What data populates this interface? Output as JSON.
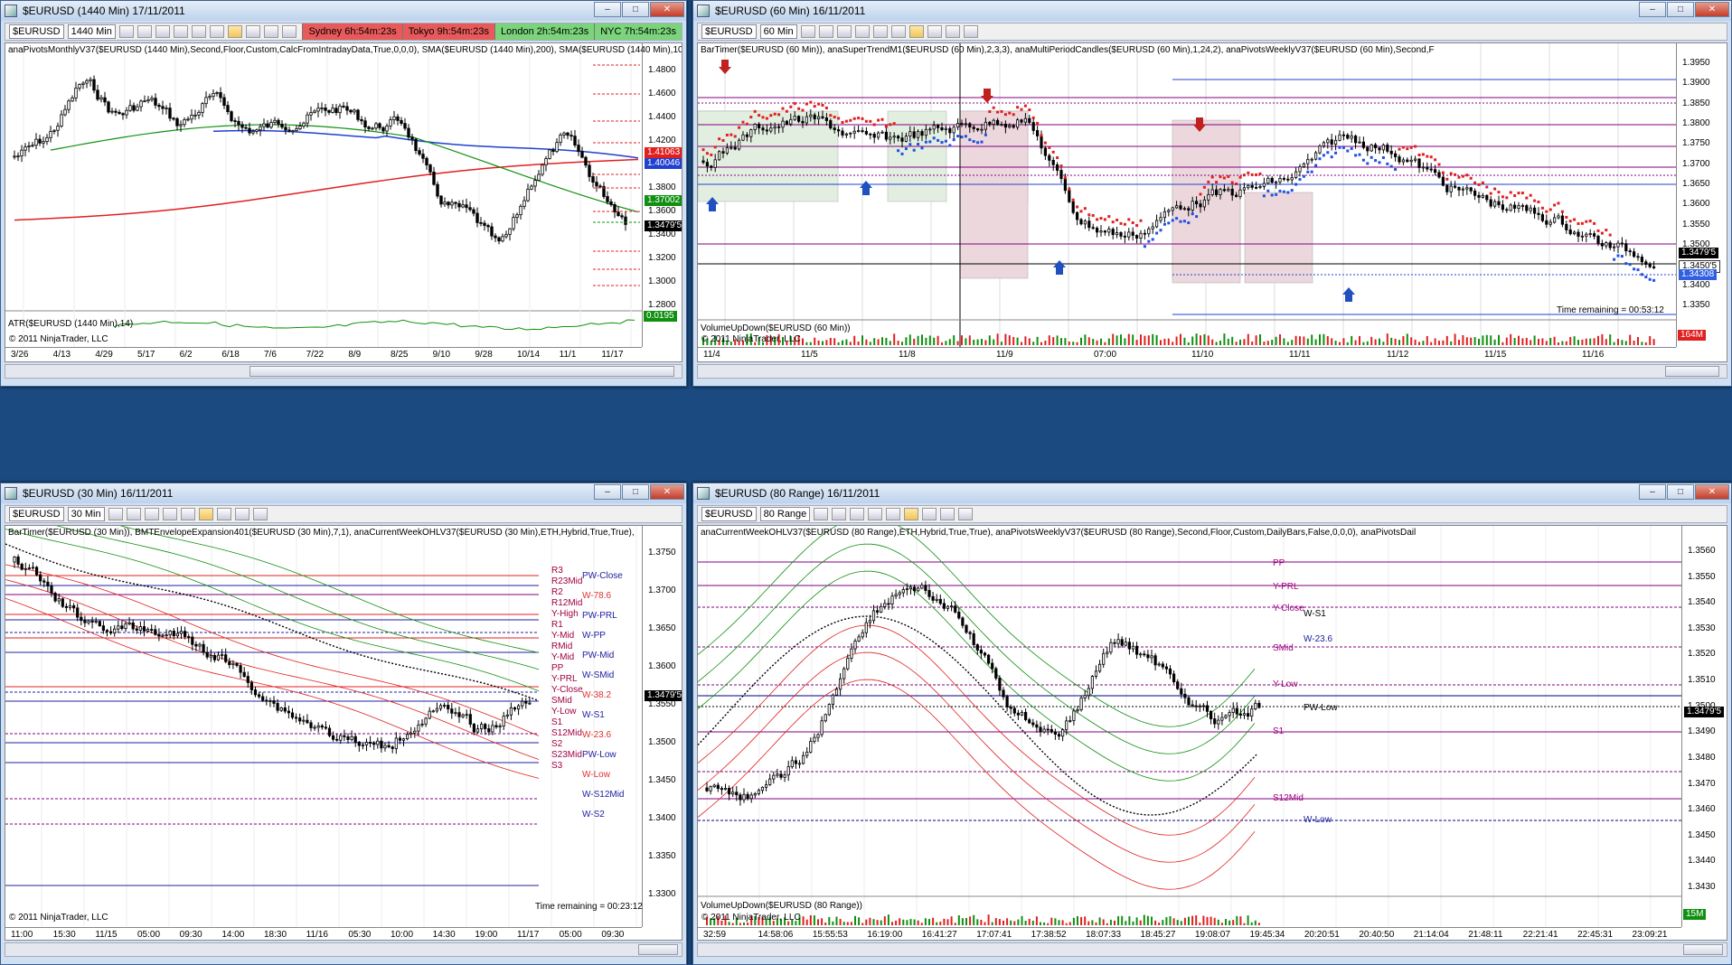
{
  "windows": [
    {
      "id": "w1",
      "title": "$EURUSD (1440 Min)  17/11/2011",
      "instrument": "$EURUSD",
      "interval": "1440 Min",
      "sessions": [
        {
          "label": "Sydney 6h:54m:23s",
          "color": "#e85a5a"
        },
        {
          "label": "Tokyo 9h:54m:23s",
          "color": "#e85a5a"
        },
        {
          "label": "London 2h:54m:23s",
          "color": "#7bd47b"
        },
        {
          "label": "NYC 7h:54m:23s",
          "color": "#7bd47b"
        }
      ],
      "indicator_label": "anaPivotsMonthlyV37($EURUSD (1440 Min),Second,Floor,Custom,CalcFromIntradayData,True,0,0,0), SMA($EURUSD (1440 Min),200), SMA($EURUSD (1440 Min),100), SM",
      "price_ticks": [
        "1.4800",
        "1.4600",
        "1.4400",
        "1.4200",
        "1.4000",
        "1.3800",
        "1.3600",
        "1.3400",
        "1.3200",
        "1.3000",
        "1.2800"
      ],
      "badges": [
        {
          "label": "1.41063",
          "color": "#e02020"
        },
        {
          "label": "1.40046",
          "color": "#2040d0"
        },
        {
          "label": "1.37002",
          "color": "#109010"
        },
        {
          "label": "1.3479'5",
          "color": "#000000"
        }
      ],
      "sub_label": "ATR($EURUSD (1440 Min),14)",
      "sub_badge": "0.0195",
      "copyright": "© 2011 NinjaTrader, LLC",
      "time_ticks": [
        "3/26",
        "4/13",
        "4/29",
        "5/17",
        "6/2",
        "6/18",
        "7/6",
        "7/22",
        "8/9",
        "8/25",
        "9/10",
        "9/28",
        "10/14",
        "11/1",
        "11/17"
      ]
    },
    {
      "id": "w2",
      "title": "$EURUSD (60 Min)  16/11/2011",
      "instrument": "$EURUSD",
      "interval": "60 Min",
      "indicator_label": "BarTimer($EURUSD (60 Min)), anaSuperTrendM1($EURUSD (60 Min),2,3,3), anaMultiPeriodCandles($EURUSD (60 Min),1,24,2), anaPivotsWeeklyV37($EURUSD (60 Min),Second,F",
      "price_ticks": [
        "1.3950",
        "1.3900",
        "1.3850",
        "1.3800",
        "1.3750",
        "1.3700",
        "1.3650",
        "1.3600",
        "1.3550",
        "1.3500",
        "1.3450",
        "1.3400",
        "1.3350"
      ],
      "badges": [
        {
          "label": "1.3479'5",
          "color": "#000000"
        },
        {
          "label": "1.3450'5",
          "color": "#ffffff"
        },
        {
          "label": "1.34308",
          "color": "#3060e0"
        }
      ],
      "time_remaining": "Time remaining = 00:53:12",
      "sub_label": "VolumeUpDown($EURUSD (60 Min))",
      "sub_badge": "164M",
      "copyright": "© 2011 NinjaTrader, LLC",
      "time_ticks": [
        "11/4",
        "11/5",
        "11/8",
        "11/9",
        "07:00",
        "11/10",
        "11/11",
        "11/12",
        "11/15",
        "11/16"
      ]
    },
    {
      "id": "w3",
      "title": "$EURUSD (30 Min)  16/11/2011",
      "instrument": "$EURUSD",
      "interval": "30 Min",
      "indicator_label": "BarTimer($EURUSD (30 Min)), BMTEnvelopeExpansion401($EURUSD (30 Min),7,1), anaCurrentWeekOHLV37($EURUSD (30 Min),ETH,Hybrid,True,True), anaPivotsWeekl",
      "price_ticks": [
        "1.3750",
        "1.3700",
        "1.3650",
        "1.3600",
        "1.3550",
        "1.3500",
        "1.3450",
        "1.3400",
        "1.3350",
        "1.3300"
      ],
      "badges": [
        {
          "label": "1.3479'5",
          "color": "#000000"
        }
      ],
      "levels": [
        {
          "label": "R3",
          "color": "#a00040"
        },
        {
          "label": "PW-Close",
          "color": "#2020a0"
        },
        {
          "label": "R23Mid",
          "color": "#a00040"
        },
        {
          "label": "W-78.6",
          "color": "#e03030"
        },
        {
          "label": "PW-PRL",
          "color": "#2020a0"
        },
        {
          "label": "R2",
          "color": "#a00040"
        },
        {
          "label": "W-PP",
          "color": "#2020a0"
        },
        {
          "label": "PW-Mid",
          "color": "#2020a0"
        },
        {
          "label": "R12Mid",
          "color": "#a00040"
        },
        {
          "label": "Y-High",
          "color": "#a00040"
        },
        {
          "label": "R1",
          "color": "#a00040"
        },
        {
          "label": "Y-Mid",
          "color": "#a00040"
        },
        {
          "label": "W-SMid",
          "color": "#2020a0"
        },
        {
          "label": "RMid",
          "color": "#a00040"
        },
        {
          "label": "W-38.2",
          "color": "#e03030"
        },
        {
          "label": "Y-Mid",
          "color": "#a00040"
        },
        {
          "label": "PP",
          "color": "#a00040"
        },
        {
          "label": "Y-PRL",
          "color": "#a00040"
        },
        {
          "label": "Y-Close",
          "color": "#a00040"
        },
        {
          "label": "W-S1",
          "color": "#2020a0"
        },
        {
          "label": "SMid",
          "color": "#a00040"
        },
        {
          "label": "W-23.6",
          "color": "#e03030"
        },
        {
          "label": "Y-Low",
          "color": "#a00040"
        },
        {
          "label": "S1",
          "color": "#a00040"
        },
        {
          "label": "PW-Low",
          "color": "#2020a0"
        },
        {
          "label": "S12Mid",
          "color": "#a00040"
        },
        {
          "label": "W-Low",
          "color": "#e03030"
        },
        {
          "label": "W-S12Mid",
          "color": "#2020a0"
        },
        {
          "label": "S2",
          "color": "#a00040"
        },
        {
          "label": "S23Mid",
          "color": "#a00040"
        },
        {
          "label": "S3",
          "color": "#a00040"
        },
        {
          "label": "W-S2",
          "color": "#2020a0"
        }
      ],
      "time_remaining": "Time remaining = 00:23:12",
      "copyright": "© 2011 NinjaTrader, LLC",
      "time_ticks": [
        "11:00",
        "15:30",
        "11/15",
        "05:00",
        "09:30",
        "14:00",
        "18:30",
        "11/16",
        "05:30",
        "10:00",
        "14:30",
        "19:00",
        "11/17",
        "05:00",
        "09:30"
      ]
    },
    {
      "id": "w4",
      "title": "$EURUSD (80 Range)  16/11/2011",
      "instrument": "$EURUSD",
      "interval": "80 Range",
      "indicator_label": "anaCurrentWeekOHLV37($EURUSD (80 Range),ETH,Hybrid,True,True), anaPivotsWeeklyV37($EURUSD (80 Range),Second,Floor,Custom,DailyBars,False,0,0,0), anaPivotsDail",
      "price_ticks": [
        "1.3560",
        "1.3550",
        "1.3540",
        "1.3530",
        "1.3520",
        "1.3510",
        "1.3500",
        "1.3490",
        "1.3480",
        "1.3470",
        "1.3460",
        "1.3450",
        "1.3440",
        "1.3430"
      ],
      "badges": [
        {
          "label": "1.3479'5",
          "color": "#000000"
        }
      ],
      "levels": [
        {
          "label": "PP",
          "color": "#a00080"
        },
        {
          "label": "Y-PRL",
          "color": "#a00080"
        },
        {
          "label": "Y-Close",
          "color": "#a00080"
        },
        {
          "label": "W-S1",
          "color": "#000000"
        },
        {
          "label": "W-23.6",
          "color": "#2020a0"
        },
        {
          "label": "SMid",
          "color": "#a00080"
        },
        {
          "label": "Y-Low",
          "color": "#a00080"
        },
        {
          "label": "PW-Low",
          "color": "#000000"
        },
        {
          "label": "S1",
          "color": "#a00080"
        },
        {
          "label": "S12Mid",
          "color": "#a00080"
        },
        {
          "label": "W-Low",
          "color": "#2020a0"
        }
      ],
      "sub_label": "VolumeUpDown($EURUSD (80 Range))",
      "sub_badge": "15M",
      "copyright": "© 2011 NinjaTrader, LLC",
      "time_ticks": [
        "32:59",
        "14:58:06",
        "15:55:53",
        "16:19:00",
        "16:41:27",
        "17:07:41",
        "17:38:52",
        "18:07:33",
        "18:45:27",
        "19:08:07",
        "19:45:34",
        "20:20:51",
        "20:40:50",
        "21:14:04",
        "21:48:11",
        "22:21:41",
        "22:45:31",
        "23:09:21"
      ]
    }
  ],
  "window_controls": {
    "minimize": "–",
    "maximize": "□",
    "close": "✕"
  }
}
